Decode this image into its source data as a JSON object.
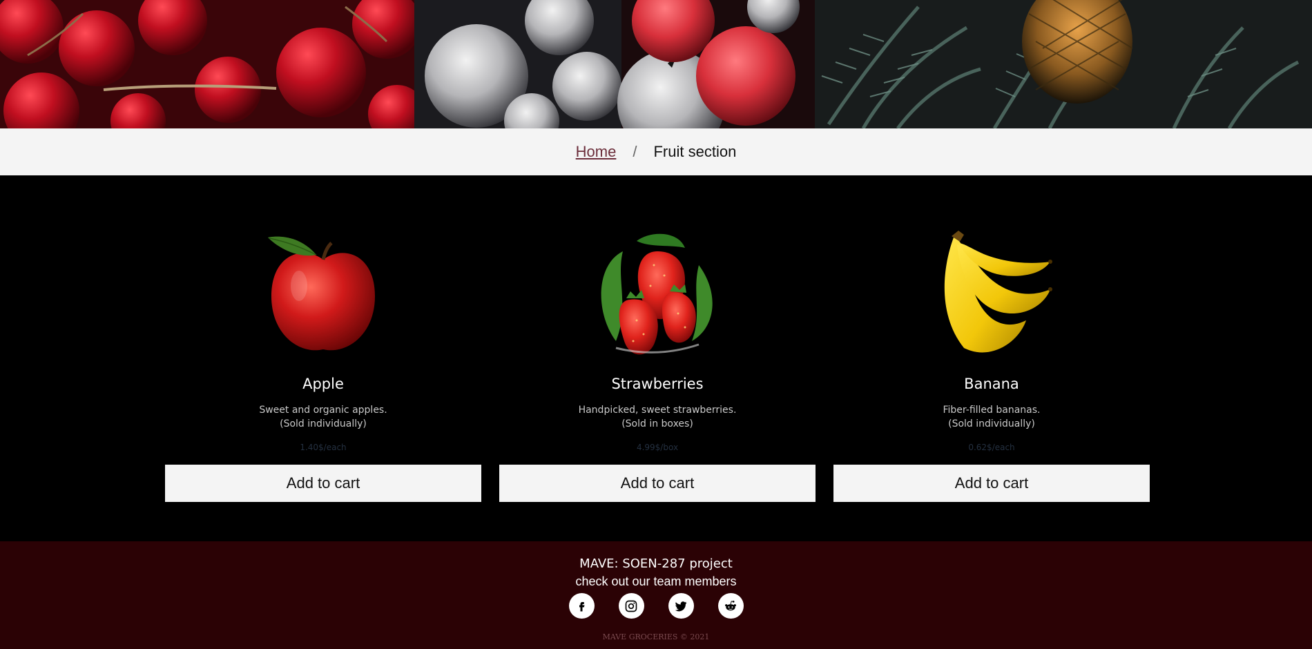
{
  "hero": {
    "image_name": "fruit-banner-image"
  },
  "breadcrumb": {
    "home": "Home",
    "separator": "/",
    "current": "Fruit section"
  },
  "products": [
    {
      "name": "Apple",
      "desc_line1": "Sweet and organic apples.",
      "desc_line2": "(Sold individually)",
      "price": "1.40$/each",
      "button": "Add to cart",
      "icon": "apple-image"
    },
    {
      "name": "Strawberries",
      "desc_line1": "Handpicked, sweet strawberries.",
      "desc_line2": "(Sold in boxes)",
      "price": "4.99$/box",
      "button": "Add to cart",
      "icon": "strawberries-image"
    },
    {
      "name": "Banana",
      "desc_line1": "Fiber-filled bananas.",
      "desc_line2": "(Sold individually)",
      "price": "0.62$/each",
      "button": "Add to cart",
      "icon": "banana-image"
    }
  ],
  "footer": {
    "project": "MAVE: SOEN-287 project",
    "team": "check out our team members",
    "socials": [
      "facebook-icon",
      "instagram-icon",
      "twitter-icon",
      "reddit-icon"
    ],
    "copyright": "MAVE GROCERIES © 2021"
  },
  "colors": {
    "page_bg": "#000000",
    "breadcrumb_bg": "#f4f4f4",
    "home_link": "#6b2d3a",
    "footer_bg": "#2b0205",
    "button_bg": "#f4f4f4"
  }
}
